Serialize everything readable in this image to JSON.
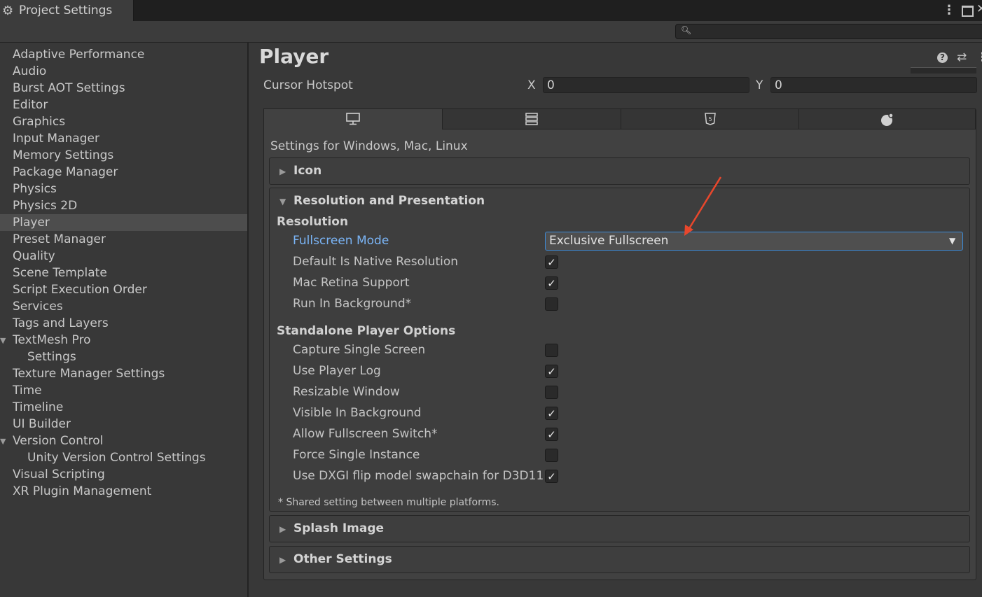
{
  "window": {
    "tab_title": "Project Settings",
    "tab_icon": "gear-icon"
  },
  "sidebar": {
    "items": [
      {
        "label": "Adaptive Performance"
      },
      {
        "label": "Audio"
      },
      {
        "label": "Burst AOT Settings"
      },
      {
        "label": "Editor"
      },
      {
        "label": "Graphics"
      },
      {
        "label": "Input Manager"
      },
      {
        "label": "Memory Settings"
      },
      {
        "label": "Package Manager"
      },
      {
        "label": "Physics"
      },
      {
        "label": "Physics 2D"
      },
      {
        "label": "Player",
        "selected": true
      },
      {
        "label": "Preset Manager"
      },
      {
        "label": "Quality"
      },
      {
        "label": "Scene Template"
      },
      {
        "label": "Script Execution Order"
      },
      {
        "label": "Services"
      },
      {
        "label": "Tags and Layers"
      },
      {
        "label": "TextMesh Pro",
        "expanded": true
      },
      {
        "label": "Settings",
        "child": true
      },
      {
        "label": "Texture Manager Settings"
      },
      {
        "label": "Time"
      },
      {
        "label": "Timeline"
      },
      {
        "label": "UI Builder"
      },
      {
        "label": "Version Control",
        "expanded": true
      },
      {
        "label": "Unity Version Control Settings",
        "child": true
      },
      {
        "label": "Visual Scripting"
      },
      {
        "label": "XR Plugin Management"
      }
    ]
  },
  "main": {
    "title": "Player",
    "cursor_hotspot": {
      "label": "Cursor Hotspot",
      "x_label": "X",
      "x_value": "0",
      "y_label": "Y",
      "y_value": "0"
    },
    "platform_tabs": [
      {
        "icon": "desktop-icon",
        "active": true
      },
      {
        "icon": "server-icon",
        "active": false
      },
      {
        "icon": "html5-icon",
        "active": false
      },
      {
        "icon": "android-icon",
        "active": false
      }
    ],
    "settings_for": "Settings for Windows, Mac, Linux",
    "icon_section": "Icon",
    "resolution_section": "Resolution and Presentation",
    "resolution_header": "Resolution",
    "fullscreen_mode": {
      "label": "Fullscreen Mode",
      "value": "Exclusive Fullscreen"
    },
    "resolution_options": [
      {
        "label": "Default Is Native Resolution",
        "checked": true
      },
      {
        "label": "Mac Retina Support",
        "checked": true
      },
      {
        "label": "Run In Background*",
        "checked": false
      }
    ],
    "standalone_header": "Standalone Player Options",
    "standalone_options": [
      {
        "label": "Capture Single Screen",
        "checked": false
      },
      {
        "label": "Use Player Log",
        "checked": true
      },
      {
        "label": "Resizable Window",
        "checked": false
      },
      {
        "label": "Visible In Background",
        "checked": true
      },
      {
        "label": "Allow Fullscreen Switch*",
        "checked": true
      },
      {
        "label": "Force Single Instance",
        "checked": false
      },
      {
        "label": "Use DXGI flip model swapchain for D3D11",
        "checked": true
      }
    ],
    "footnote": "* Shared setting between multiple platforms.",
    "splash_section": "Splash Image",
    "other_section": "Other Settings"
  },
  "annotation": {
    "color": "#e8472c"
  }
}
